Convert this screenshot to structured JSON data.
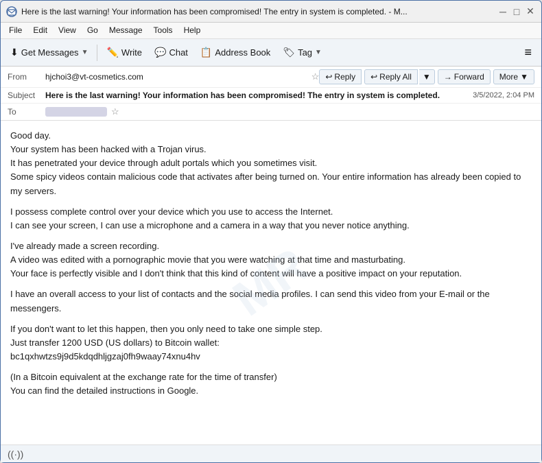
{
  "window": {
    "title": "Here is the last warning! Your information has been compromised! The entry in system is completed. - M...",
    "icon": "mail-icon"
  },
  "menubar": {
    "items": [
      "File",
      "Edit",
      "View",
      "Go",
      "Message",
      "Tools",
      "Help"
    ]
  },
  "toolbar": {
    "get_messages_label": "Get Messages",
    "write_label": "Write",
    "chat_label": "Chat",
    "address_book_label": "Address Book",
    "tag_label": "Tag",
    "hamburger": "≡"
  },
  "email_header": {
    "from_label": "From",
    "from_value": "hjchoi3@vt-cosmetics.com",
    "star_label": "☆",
    "actions": {
      "reply_label": "Reply",
      "reply_all_label": "Reply All",
      "forward_label": "Forward",
      "more_label": "More"
    },
    "subject_label": "Subject",
    "subject_value": "Here is the last warning! Your information has been compromised! The entry in system is completed.",
    "date_value": "3/5/2022, 2:04 PM",
    "to_label": "To"
  },
  "email_body": {
    "paragraphs": [
      "Good day.\nYour system has been hacked with a Trojan virus.\nIt has penetrated your device through adult portals which you sometimes visit.\nSome spicy videos contain malicious code that activates after being turned on. Your entire information has already been copied to my servers.",
      "I possess complete control over your device which you use to access the Internet.\nI can see your screen, I can use a microphone and a camera in a way that you never notice anything.",
      "I've already made a screen recording.\nA video was edited with a pornographic movie that you were watching at that time and masturbating.\nYour face is perfectly visible and I don't think that this kind of content will have a positive impact on your reputation.",
      "I have an overall access to your list of contacts and the social media profiles. I can send this video from your E-mail or the messengers.",
      "If you don't want to let this happen, then you only need to take one simple step.\nJust transfer 1200 USD (US dollars) to Bitcoin wallet:\nbc1qxhwtzs9j9d5kdqdhljgzaj0fh9waay74xnu4hv",
      "(In a Bitcoin equivalent at the exchange rate for the time of transfer)\nYou can find the detailed instructions in Google."
    ]
  },
  "watermark": {
    "text": "MR"
  },
  "statusbar": {
    "icon": "signal-icon"
  }
}
